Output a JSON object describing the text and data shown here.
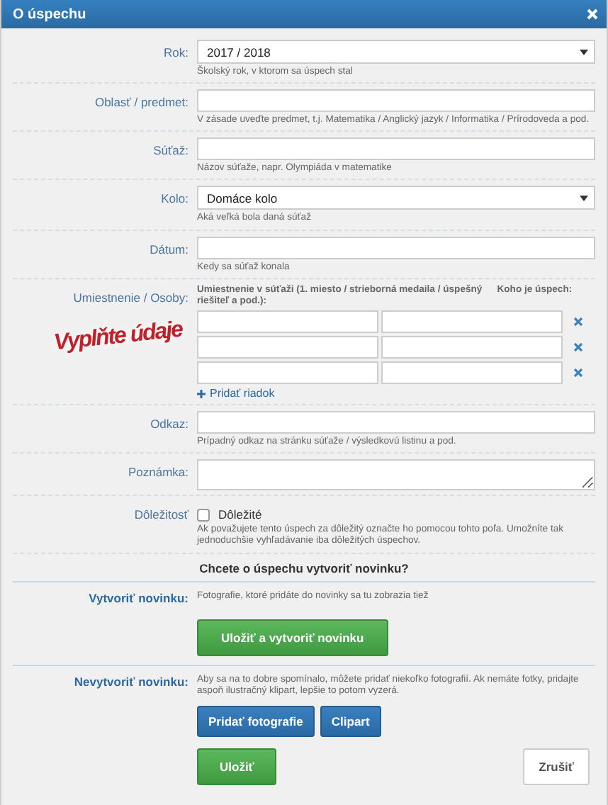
{
  "dialog": {
    "title": "O úspechu"
  },
  "fields": [
    {
      "kind": "select",
      "label": "Rok:",
      "value": "2017 / 2018",
      "hint": "Školský rok, v ktorom sa úspech stal"
    },
    {
      "kind": "text",
      "label": "Oblasť / predmet:",
      "hint": "V zásade uveďte predmet, t.j. Matematika / Anglický jazyk / Informatika / Prírodoveda a pod."
    },
    {
      "kind": "text",
      "label": "Súťaž:",
      "hint": "Názov súťaže, napr. Olympiáda v matematike"
    },
    {
      "kind": "select",
      "label": "Kolo:",
      "value": "Domáce kolo",
      "hint": "Aká veľká bola daná súťaž"
    },
    {
      "kind": "text",
      "label": "Dátum:",
      "hint": "Kedy sa súťaž konala"
    },
    {
      "kind": "persons",
      "label": "Umiestnenie / Osoby:",
      "hint_left": "Umiestnenie v súťaži (1. miesto / strieborná medaila / úspešný riešiteľ a pod.):",
      "hint_right": "Koho je úspech:",
      "rows": [
        {
          "kind": "pair"
        },
        {
          "kind": "pair"
        },
        {
          "kind": "pair"
        }
      ],
      "add_link": "Pridať riadok"
    },
    {
      "kind": "text",
      "label": "Odkaz:",
      "hint": "Prípadný odkaz na stránku súťaže / výsledkovú listinu a pod."
    },
    {
      "kind": "textarea",
      "label": "Poznámka:"
    },
    {
      "kind": "checkbox",
      "label": "Dôležitosť",
      "checkbox_label": "Dôležité",
      "checked": false,
      "hint": "Ak považujete tento úspech za dôležitý označte ho pomocou tohto poľa. Umožníte tak jednoduchšie vyhľadávanie iba dôležitých úspechov."
    }
  ],
  "news_question": "Chcete o úspechu vytvoriť novinku?",
  "create_news": {
    "label": "Vytvoriť novinku:",
    "text": "Fotografie, ktoré pridáte do novinky sa tu zobrazia tiež",
    "button": "Uložiť a vytvoriť novinku"
  },
  "no_news": {
    "label": "Nevytvoriť novinku:",
    "text": "Aby sa na to dobre spomínalo, môžete pridať niekoľko fotografií. Ak nemáte fotky, pridajte aspoň ilustračný klipart, lepšie to potom vyzerá.",
    "buttons": [
      "Pridať fotografie",
      "Clipart"
    ]
  },
  "footer": {
    "save": "Uložiť",
    "cancel": "Zrušiť"
  },
  "stamp": "Vyplňte údaje"
}
